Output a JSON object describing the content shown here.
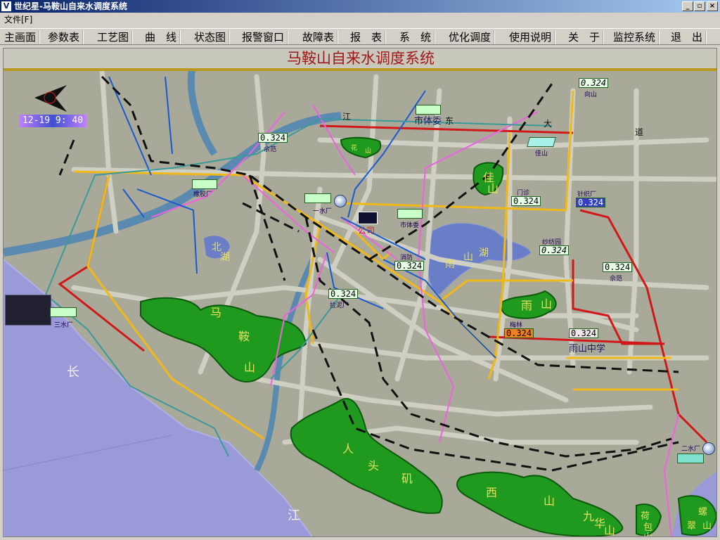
{
  "window": {
    "title": "世纪星-马鞍山自来水调度系统",
    "app_icon": "V",
    "buttons": [
      "_",
      "▫",
      "×"
    ]
  },
  "menu": {
    "file": "文件[F]"
  },
  "toolbar": [
    "主画面",
    "参数表",
    "工艺图",
    "曲　线",
    "状态图",
    "报警窗口",
    "故障表",
    "报　表",
    "系　统",
    "优化调度",
    "使用说明",
    "关　于",
    "监控系统",
    "退　出"
  ],
  "map": {
    "title": "马鞍山自来水调度系统",
    "clock": "12-19 9: 40",
    "stations": {
      "xiang_shan": {
        "value": "0.324",
        "label": "向山"
      },
      "she_fan": {
        "value": "0.324",
        "label": "佘范"
      },
      "shi_ti_wei_top": {
        "label": "市体委"
      },
      "jia_shan": {
        "label": "佳山"
      },
      "xiang_jiao_chang": {
        "label": "橡胶厂"
      },
      "yi_shui_chang": {
        "label": "一水厂"
      },
      "gong_si": {
        "label": "公司"
      },
      "shi_ti_wei": {
        "label": "市体委"
      },
      "men_shi": {
        "value": "0.324",
        "label": "门诊"
      },
      "zhen_zhi_chang": {
        "value": "0.324",
        "label": "针织厂"
      },
      "sha_fang_yuan": {
        "value": "0.324",
        "label": "纱纺园"
      },
      "xiao_fang": {
        "value": "0.324",
        "label": "消防"
      },
      "she_fan_2": {
        "value": "0.324",
        "label": "佘范"
      },
      "la_ni_chang": {
        "value": "0.324",
        "label": "拉泥厂"
      },
      "mei_lin": {
        "value": "0.324",
        "label": "梅林"
      },
      "yu_shan_zhong_xue": {
        "value": "0.324",
        "label": "雨山中学"
      },
      "san_shui_chang": {
        "label": "三水厂"
      },
      "er_shui_chang": {
        "label": "二水厂"
      }
    },
    "labels": {
      "jiang": "江",
      "dong": "东",
      "da": "大",
      "dao": "道",
      "bei_hu_1": "北",
      "bei_hu_2": "湖",
      "yu_1": "雨",
      "shan_hu": "山",
      "hu": "湖",
      "ma": "马",
      "an": "鞍",
      "shan": "山",
      "yu_shan_1": "雨",
      "yu_shan_2": "山",
      "jia_1": "佳",
      "jia_2": "山",
      "hua_1": "花",
      "hua_2": "山",
      "ren": "人",
      "tou": "头",
      "ji": "矶",
      "xi": "西",
      "xi_shan": "山",
      "jiu": "九",
      "hua": "华",
      "hua_shan": "山",
      "he": "荷",
      "bao": "包",
      "bao_shan": "山",
      "luo": "螺",
      "cui": "翠",
      "shan_luo": "山",
      "chang": "长",
      "river_jiang": "江"
    }
  }
}
